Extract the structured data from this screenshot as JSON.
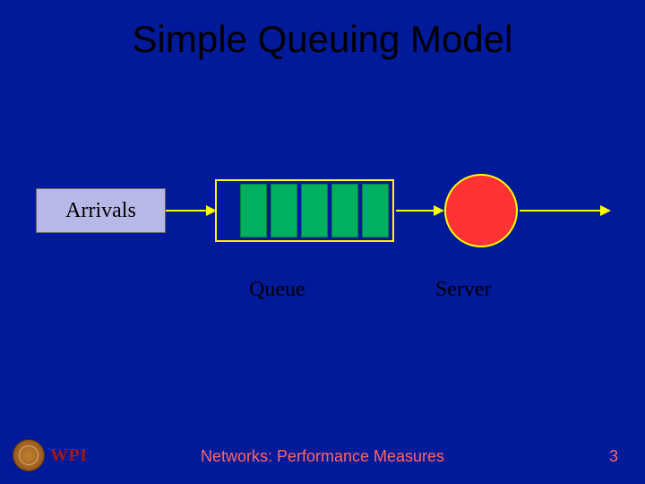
{
  "title": "Simple Queuing Model",
  "labels": {
    "arrivals": "Arrivals",
    "queue": "Queue",
    "server": "Server"
  },
  "queue": {
    "visible_slots": 5
  },
  "footer": {
    "text": "Networks: Performance Measures",
    "page_number": "3"
  },
  "logo": {
    "text": "WPI"
  }
}
